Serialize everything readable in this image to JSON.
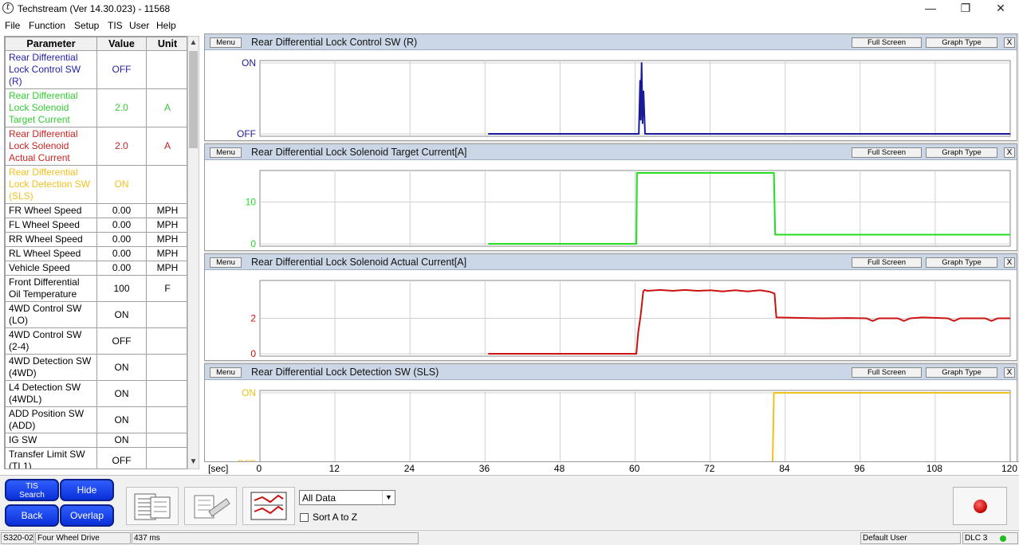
{
  "window": {
    "title": "Techstream (Ver 14.30.023) - 11568",
    "controls": {
      "minimize": "—",
      "maximize": "❐",
      "close": "✕"
    }
  },
  "menu": [
    "File",
    "Function",
    "Setup",
    "TIS",
    "User",
    "Help"
  ],
  "param_table": {
    "headers": {
      "parameter": "Parameter",
      "value": "Value",
      "unit": "Unit"
    },
    "rows": [
      {
        "name": "Rear Differential Lock Control SW (R)",
        "value": "OFF",
        "unit": "",
        "color": "#2222aa"
      },
      {
        "name": "Rear Differential Lock Solenoid Target Current",
        "value": "2.0",
        "unit": "A",
        "color": "#33cc33"
      },
      {
        "name": "Rear Differential Lock Solenoid Actual Current",
        "value": "2.0",
        "unit": "A",
        "color": "#cc2222"
      },
      {
        "name": "Rear Differential Lock Detection SW (SLS)",
        "value": "ON",
        "unit": "",
        "color": "#f2c01e"
      },
      {
        "name": "FR Wheel Speed",
        "value": "0.00",
        "unit": "MPH",
        "color": "#000000"
      },
      {
        "name": "FL Wheel Speed",
        "value": "0.00",
        "unit": "MPH",
        "color": "#000000"
      },
      {
        "name": "RR Wheel Speed",
        "value": "0.00",
        "unit": "MPH",
        "color": "#000000"
      },
      {
        "name": "RL Wheel Speed",
        "value": "0.00",
        "unit": "MPH",
        "color": "#000000"
      },
      {
        "name": "Vehicle Speed",
        "value": "0.00",
        "unit": "MPH",
        "color": "#000000"
      },
      {
        "name": "Front Differential Oil Temperature",
        "value": "100",
        "unit": "F",
        "color": "#000000"
      },
      {
        "name": "4WD Control SW (LO)",
        "value": "ON",
        "unit": "",
        "color": "#000000"
      },
      {
        "name": "4WD Control SW (2-4)",
        "value": "OFF",
        "unit": "",
        "color": "#000000"
      },
      {
        "name": "4WD Detection SW (4WD)",
        "value": "ON",
        "unit": "",
        "color": "#000000"
      },
      {
        "name": "L4 Detection SW (4WDL)",
        "value": "ON",
        "unit": "",
        "color": "#000000"
      },
      {
        "name": "ADD Position SW (ADD)",
        "value": "ON",
        "unit": "",
        "color": "#000000"
      },
      {
        "name": "IG SW",
        "value": "ON",
        "unit": "",
        "color": "#000000"
      },
      {
        "name": "Transfer Limit SW (TL1)",
        "value": "OFF",
        "unit": "",
        "color": "#000000"
      }
    ]
  },
  "graph_buttons": {
    "menu": "Menu",
    "full_screen": "Full Screen",
    "graph_type": "Graph Type",
    "close": "X"
  },
  "chart_data": [
    {
      "type": "line",
      "title": "Rear Differential Lock Control SW (R)",
      "color": "#1a1a99",
      "xlim": [
        0,
        120
      ],
      "ylim": [
        0,
        1
      ],
      "yticks": [
        {
          "value": 1,
          "label": "ON"
        },
        {
          "value": 0,
          "label": "OFF"
        }
      ],
      "points": [
        [
          36.5,
          0
        ],
        [
          60.6,
          0
        ],
        [
          60.8,
          0.75
        ],
        [
          60.9,
          0.2
        ],
        [
          61.05,
          1
        ],
        [
          61.2,
          0.15
        ],
        [
          61.35,
          0.6
        ],
        [
          61.6,
          0
        ],
        [
          120,
          0
        ]
      ]
    },
    {
      "type": "line",
      "title": "Rear Differential Lock Solenoid Target Current[A]",
      "color": "#22dd22",
      "xlim": [
        0,
        120
      ],
      "ylim": [
        0,
        17
      ],
      "yticks": [
        {
          "value": 10,
          "label": "10"
        },
        {
          "value": 0,
          "label": "0"
        }
      ],
      "points": [
        [
          36.5,
          0
        ],
        [
          60.2,
          0
        ],
        [
          60.3,
          17
        ],
        [
          82.2,
          17
        ],
        [
          82.4,
          2.2
        ],
        [
          120,
          2.2
        ]
      ]
    },
    {
      "type": "line",
      "title": "Rear Differential Lock Solenoid Actual Current[A]",
      "color": "#cc1111",
      "xlim": [
        0,
        120
      ],
      "ylim": [
        0,
        4
      ],
      "yticks": [
        {
          "value": 2,
          "label": "2"
        },
        {
          "value": 0,
          "label": "0"
        }
      ],
      "points": [
        [
          36.5,
          0
        ],
        [
          60.2,
          0
        ],
        [
          60.5,
          1.2
        ],
        [
          60.9,
          2.2
        ],
        [
          61.3,
          3.5
        ],
        [
          61.5,
          3.6
        ],
        [
          62,
          3.55
        ],
        [
          64,
          3.6
        ],
        [
          66,
          3.55
        ],
        [
          68,
          3.6
        ],
        [
          70,
          3.55
        ],
        [
          72,
          3.58
        ],
        [
          74,
          3.52
        ],
        [
          76,
          3.58
        ],
        [
          78,
          3.52
        ],
        [
          80,
          3.58
        ],
        [
          81.5,
          3.5
        ],
        [
          82.3,
          3.4
        ],
        [
          82.6,
          2.05
        ],
        [
          90,
          2.0
        ],
        [
          94,
          2.02
        ],
        [
          97,
          2.0
        ],
        [
          98,
          1.85
        ],
        [
          99,
          2.0
        ],
        [
          102,
          2.0
        ],
        [
          103,
          1.85
        ],
        [
          104,
          2.0
        ],
        [
          106,
          2.05
        ],
        [
          110,
          2.0
        ],
        [
          111,
          1.85
        ],
        [
          112,
          2.0
        ],
        [
          116,
          2.0
        ],
        [
          117,
          1.85
        ],
        [
          118,
          2.0
        ],
        [
          120,
          2.0
        ]
      ]
    },
    {
      "type": "line",
      "title": "Rear Differential Lock Detection SW (SLS)",
      "color": "#f2c01e",
      "xlim": [
        0,
        120
      ],
      "ylim": [
        0,
        1
      ],
      "yticks": [
        {
          "value": 1,
          "label": "ON"
        },
        {
          "value": 0,
          "label": "OFF"
        }
      ],
      "points": [
        [
          36.5,
          0
        ],
        [
          82.0,
          0
        ],
        [
          82.2,
          1
        ],
        [
          120,
          1
        ]
      ]
    }
  ],
  "x_axis": {
    "unit_label": "[sec]",
    "ticks": [
      0,
      12,
      24,
      36,
      48,
      60,
      72,
      84,
      96,
      108,
      120
    ]
  },
  "toolbar": {
    "tis_search": [
      "TIS",
      "Search"
    ],
    "hide": "Hide",
    "back": "Back",
    "overlap": "Overlap",
    "filter_value": "All Data",
    "sort_label": "Sort A to Z",
    "sort_checked": false
  },
  "statusbar": {
    "code": "S320-02",
    "system": "Four Wheel Drive",
    "interval": "437 ms",
    "user": "Default User",
    "connection": "DLC 3",
    "connection_color": "#22bb22"
  }
}
